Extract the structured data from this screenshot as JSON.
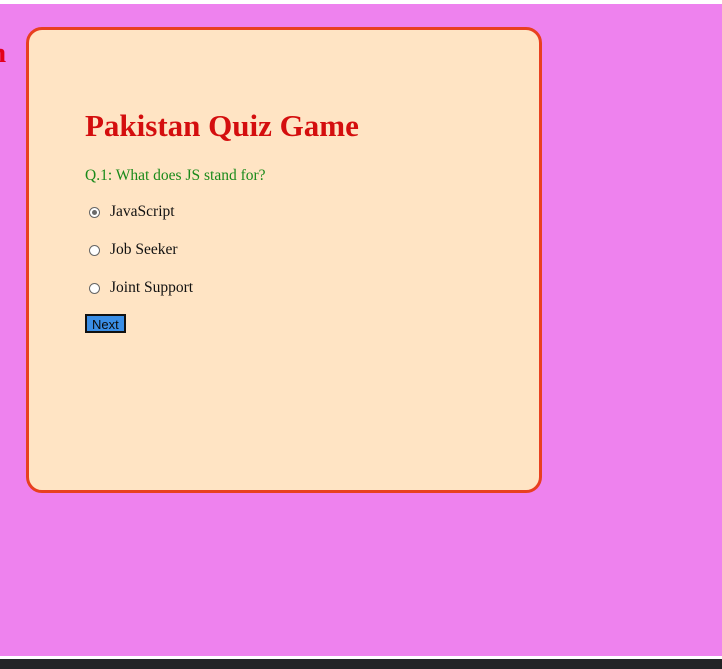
{
  "edge_heading_fragment": "n",
  "quiz": {
    "title": "Pakistan Quiz Game",
    "question": "Q.1: What does JS stand for?",
    "options": [
      {
        "label": "JavaScript",
        "selected": true
      },
      {
        "label": "Job Seeker",
        "selected": false
      },
      {
        "label": "Joint Support",
        "selected": false
      }
    ],
    "next_label": "Next"
  },
  "colors": {
    "page_background": "#ee82ee",
    "card_background": "#ffe4c4",
    "card_border": "#e8401f",
    "title": "#d40e0e",
    "question": "#1a8a1a",
    "next_button": "#3a8ee6"
  }
}
